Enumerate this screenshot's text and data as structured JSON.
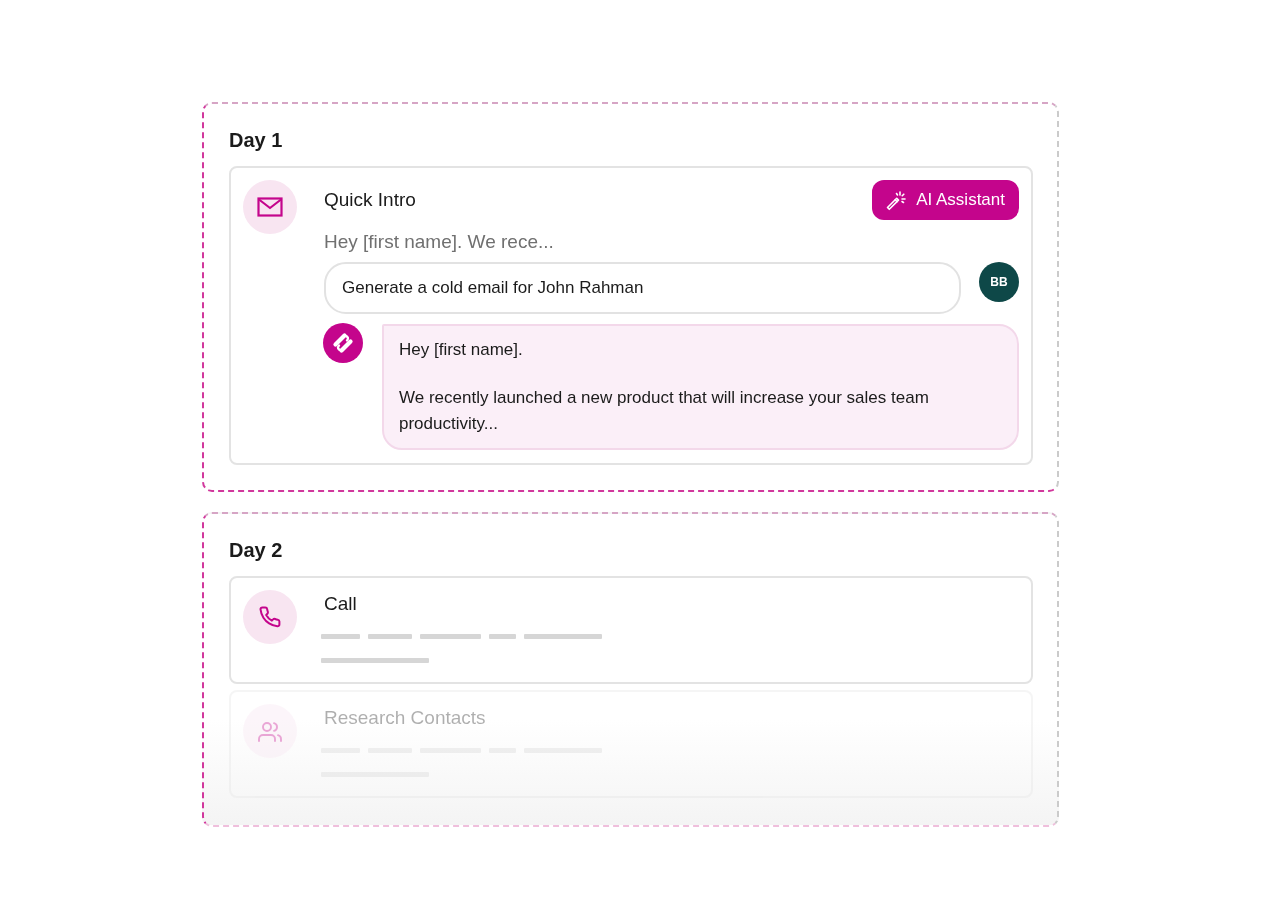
{
  "days": [
    {
      "label": "Day 1",
      "steps": [
        {
          "kind": "email",
          "title": "Quick Intro",
          "faded": false,
          "preview": "Hey [first name]. We rece...",
          "ai_button": {
            "label": "AI Assistant"
          },
          "prompt": {
            "value": "Generate a cold email for John Rahman"
          },
          "user": {
            "initials": "BB"
          },
          "response": [
            "Hey [first name].",
            "We recently launched a new product that will increase your sales team productivity..."
          ]
        }
      ]
    },
    {
      "label": "Day 2",
      "steps": [
        {
          "kind": "call",
          "title": "Call",
          "faded": false
        },
        {
          "kind": "research",
          "title": "Research Contacts",
          "faded": true
        }
      ]
    }
  ]
}
